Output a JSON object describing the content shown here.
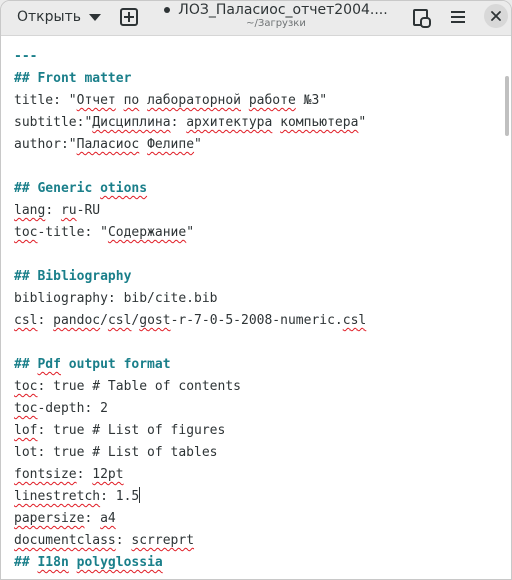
{
  "header": {
    "open_label": "Открыть",
    "title": "ЛОЗ_Паласиос_отчет2004....",
    "subtitle": "~/Загрузки"
  },
  "icons": {
    "open_menu": "chevron-down-icon",
    "new_tab": "new-tab-icon",
    "save_copy": "document-search-icon",
    "menu": "hamburger-menu-icon",
    "close": "close-icon"
  },
  "colors": {
    "heading": "#1a7f8a",
    "spellcheck": "#e01b24",
    "text": "#2e3436"
  },
  "editor": {
    "lines": [
      {
        "segments": [
          {
            "t": "---",
            "c": "h"
          }
        ]
      },
      {
        "segments": [
          {
            "t": "## Front matter",
            "c": "h"
          }
        ]
      },
      {
        "segments": [
          {
            "t": "title: \""
          },
          {
            "t": "Отчет",
            "c": "sq"
          },
          {
            "t": " "
          },
          {
            "t": "по",
            "c": "sq"
          },
          {
            "t": " "
          },
          {
            "t": "лабораторной",
            "c": "sq"
          },
          {
            "t": " "
          },
          {
            "t": "работе",
            "c": "sq"
          },
          {
            "t": " №3\""
          }
        ]
      },
      {
        "segments": [
          {
            "t": "subtitle:\""
          },
          {
            "t": "Дисциплина",
            "c": "sq"
          },
          {
            "t": ": "
          },
          {
            "t": "архитектура",
            "c": "sq"
          },
          {
            "t": " "
          },
          {
            "t": "компьютера",
            "c": "sq"
          },
          {
            "t": "\""
          }
        ]
      },
      {
        "segments": [
          {
            "t": "author:\""
          },
          {
            "t": "Паласиос",
            "c": "sq"
          },
          {
            "t": " "
          },
          {
            "t": "Фелипе",
            "c": "sq"
          },
          {
            "t": "\""
          }
        ]
      },
      {
        "segments": [
          {
            "t": ""
          }
        ]
      },
      {
        "segments": [
          {
            "t": "## Generic ",
            "c": "h"
          },
          {
            "t": "otions",
            "c": "h sq"
          }
        ]
      },
      {
        "segments": [
          {
            "t": "lang",
            "c": "sq"
          },
          {
            "t": ": "
          },
          {
            "t": "ru",
            "c": "sq"
          },
          {
            "t": "-RU"
          }
        ]
      },
      {
        "segments": [
          {
            "t": "toc",
            "c": "sq"
          },
          {
            "t": "-title: \""
          },
          {
            "t": "Содержание",
            "c": "sq"
          },
          {
            "t": "\""
          }
        ]
      },
      {
        "segments": [
          {
            "t": ""
          }
        ]
      },
      {
        "segments": [
          {
            "t": "## Bibliography",
            "c": "h"
          }
        ]
      },
      {
        "segments": [
          {
            "t": "bibliography: bib/cite.bib"
          }
        ]
      },
      {
        "segments": [
          {
            "t": "csl",
            "c": "sq"
          },
          {
            "t": ": "
          },
          {
            "t": "pandoc",
            "c": "sq"
          },
          {
            "t": "/"
          },
          {
            "t": "csl",
            "c": "sq"
          },
          {
            "t": "/"
          },
          {
            "t": "gost",
            "c": "sq"
          },
          {
            "t": "-r-7-0-5-2008-numeric."
          },
          {
            "t": "csl",
            "c": "sq"
          }
        ]
      },
      {
        "segments": [
          {
            "t": ""
          }
        ]
      },
      {
        "segments": [
          {
            "t": "## ",
            "c": "h"
          },
          {
            "t": "Pdf",
            "c": "h sq"
          },
          {
            "t": " output format",
            "c": "h"
          }
        ]
      },
      {
        "segments": [
          {
            "t": "toc",
            "c": "sq"
          },
          {
            "t": ": true # Table of contents"
          }
        ]
      },
      {
        "segments": [
          {
            "t": "toc",
            "c": "sq"
          },
          {
            "t": "-depth: 2"
          }
        ]
      },
      {
        "segments": [
          {
            "t": "lof",
            "c": "sq"
          },
          {
            "t": ": true # List of figures"
          }
        ]
      },
      {
        "segments": [
          {
            "t": "lot: true # List of tables"
          }
        ]
      },
      {
        "segments": [
          {
            "t": "fontsize",
            "c": "sq"
          },
          {
            "t": ": "
          },
          {
            "t": "12pt",
            "c": "sq"
          }
        ]
      },
      {
        "segments": [
          {
            "t": "linestretch",
            "c": "sq"
          },
          {
            "t": ": 1.5"
          },
          {
            "caret": true
          }
        ]
      },
      {
        "segments": [
          {
            "t": "papersize",
            "c": "sq"
          },
          {
            "t": ": "
          },
          {
            "t": "a4",
            "c": "sq"
          }
        ]
      },
      {
        "segments": [
          {
            "t": "documentclass",
            "c": "sq"
          },
          {
            "t": ": "
          },
          {
            "t": "scrreprt",
            "c": "sq"
          }
        ]
      },
      {
        "segments": [
          {
            "t": "## ",
            "c": "h"
          },
          {
            "t": "I18n",
            "c": "h sq"
          },
          {
            "t": " ",
            "c": "h"
          },
          {
            "t": "polyglossia",
            "c": "h sq"
          }
        ]
      }
    ]
  }
}
